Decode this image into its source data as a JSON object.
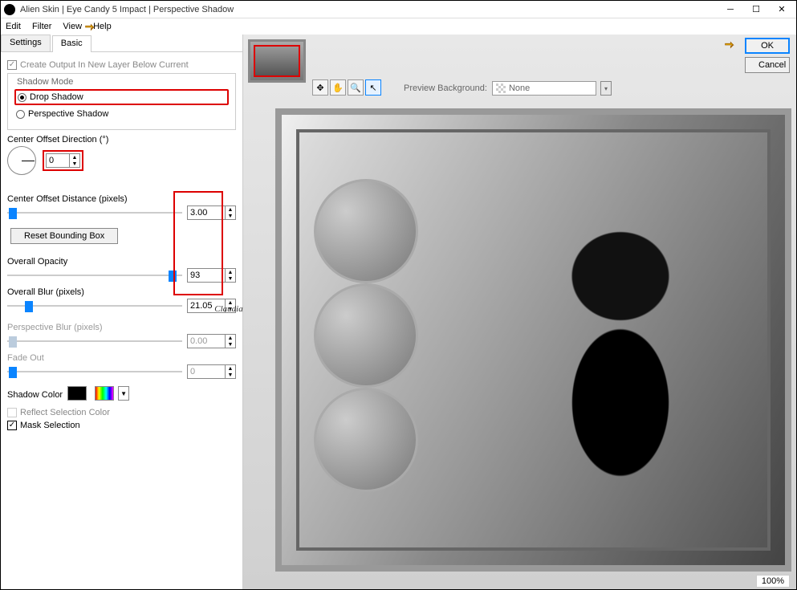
{
  "window": {
    "title": "Alien Skin | Eye Candy 5 Impact | Perspective Shadow"
  },
  "menu": {
    "edit": "Edit",
    "filter": "Filter",
    "view": "View",
    "help": "Help"
  },
  "tabs": {
    "settings": "Settings",
    "basic": "Basic"
  },
  "createOutput": "Create Output In New Layer Below Current",
  "shadowMode": {
    "legend": "Shadow Mode",
    "drop": "Drop Shadow",
    "perspective": "Perspective Shadow"
  },
  "centerOffsetDir": {
    "label": "Center Offset Direction (°)",
    "value": "0"
  },
  "centerOffsetDist": {
    "label": "Center Offset Distance (pixels)",
    "value": "3.00"
  },
  "resetBB": "Reset Bounding Box",
  "overallOpacity": {
    "label": "Overall Opacity",
    "value": "93"
  },
  "overallBlur": {
    "label": "Overall Blur (pixels)",
    "value": "21.05"
  },
  "perspectiveBlur": {
    "label": "Perspective Blur (pixels)",
    "value": "0.00"
  },
  "fadeOut": {
    "label": "Fade Out",
    "value": "0"
  },
  "shadowColor": "Shadow Color",
  "reflectSel": "Reflect Selection Color",
  "maskSel": "Mask Selection",
  "buttons": {
    "ok": "OK",
    "cancel": "Cancel"
  },
  "previewBg": {
    "label": "Preview Background:",
    "value": "None"
  },
  "zoom": "100%",
  "watermark": "Claudia",
  "colors": {
    "shadow": "#000000"
  }
}
